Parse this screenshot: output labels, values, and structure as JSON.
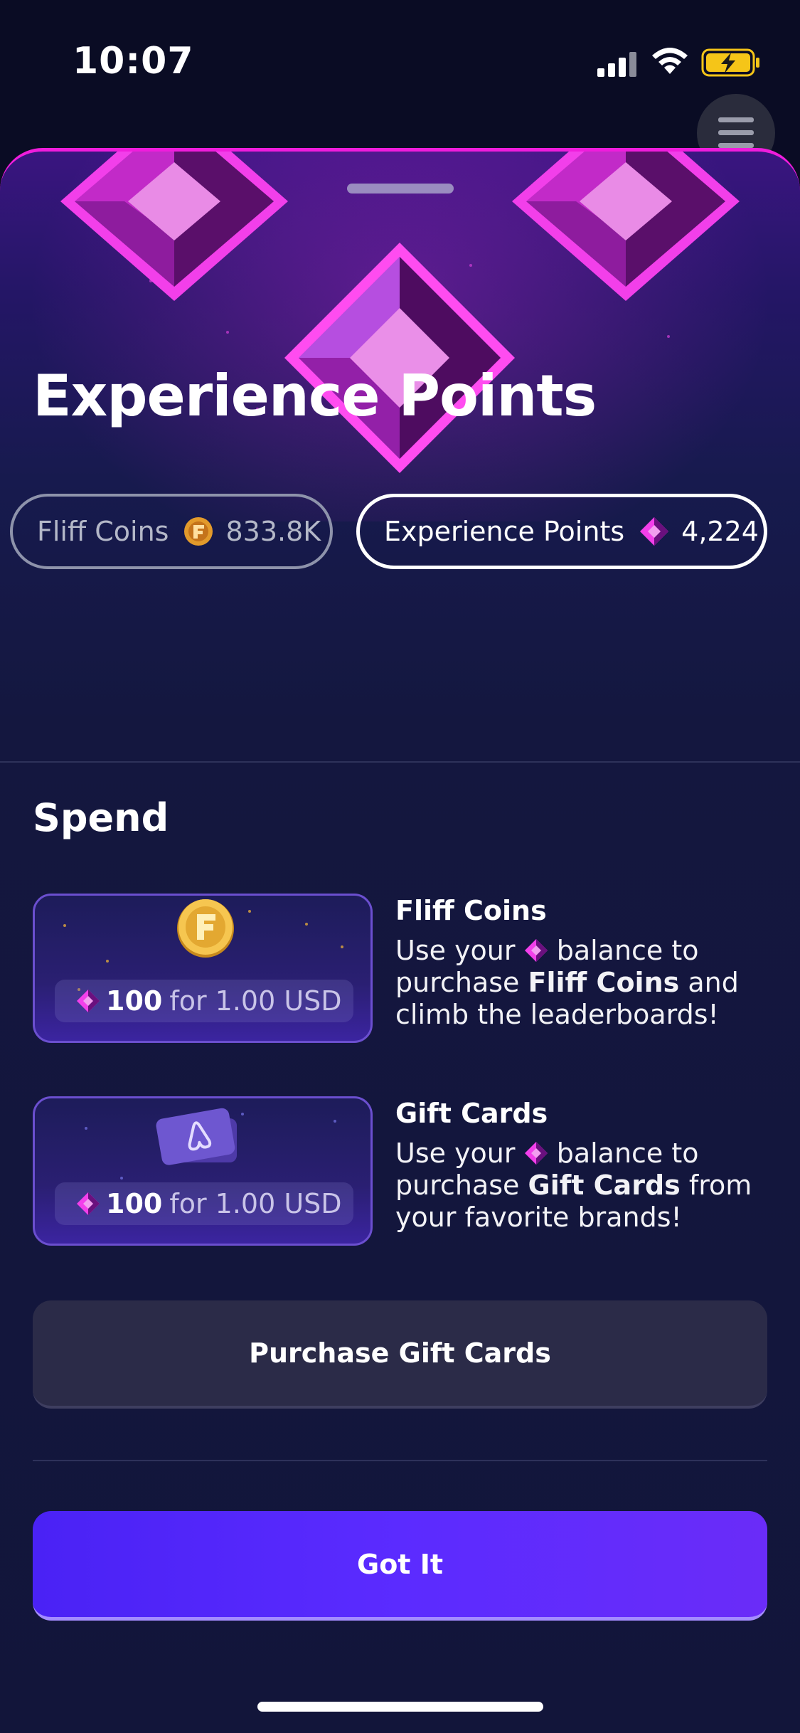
{
  "status_bar": {
    "time": "10:07"
  },
  "sheet": {
    "title": "Experience Points"
  },
  "balances": {
    "coins": {
      "label": "Fliff Coins",
      "value": "833.8K"
    },
    "xp": {
      "label": "Experience Points",
      "value": "4,224"
    }
  },
  "spend": {
    "heading": "Spend",
    "items": [
      {
        "amount": "100",
        "price": "for 1.00 USD",
        "title": "Fliff Coins",
        "text_a": "Use your",
        "text_b": "balance to purchase",
        "text_bold": "Fliff Coins",
        "text_c": "and climb the leaderboards!"
      },
      {
        "amount": "100",
        "price": "for 1.00 USD",
        "title": "Gift Cards",
        "text_a": "Use your",
        "text_b": "balance to purchase",
        "text_bold": "Gift Cards",
        "text_c": "from your favorite brands!"
      }
    ]
  },
  "buttons": {
    "purchase_gift_cards": "Purchase Gift Cards",
    "got_it": "Got It"
  },
  "icons": {
    "xp": "gem-icon",
    "coin": "fliff-coin-icon",
    "gift_card": "gift-card-icon",
    "menu": "menu-icon"
  },
  "colors": {
    "accent_magenta": "#f01ddc",
    "primary_button": "#5b2bff",
    "background": "#12153a"
  }
}
